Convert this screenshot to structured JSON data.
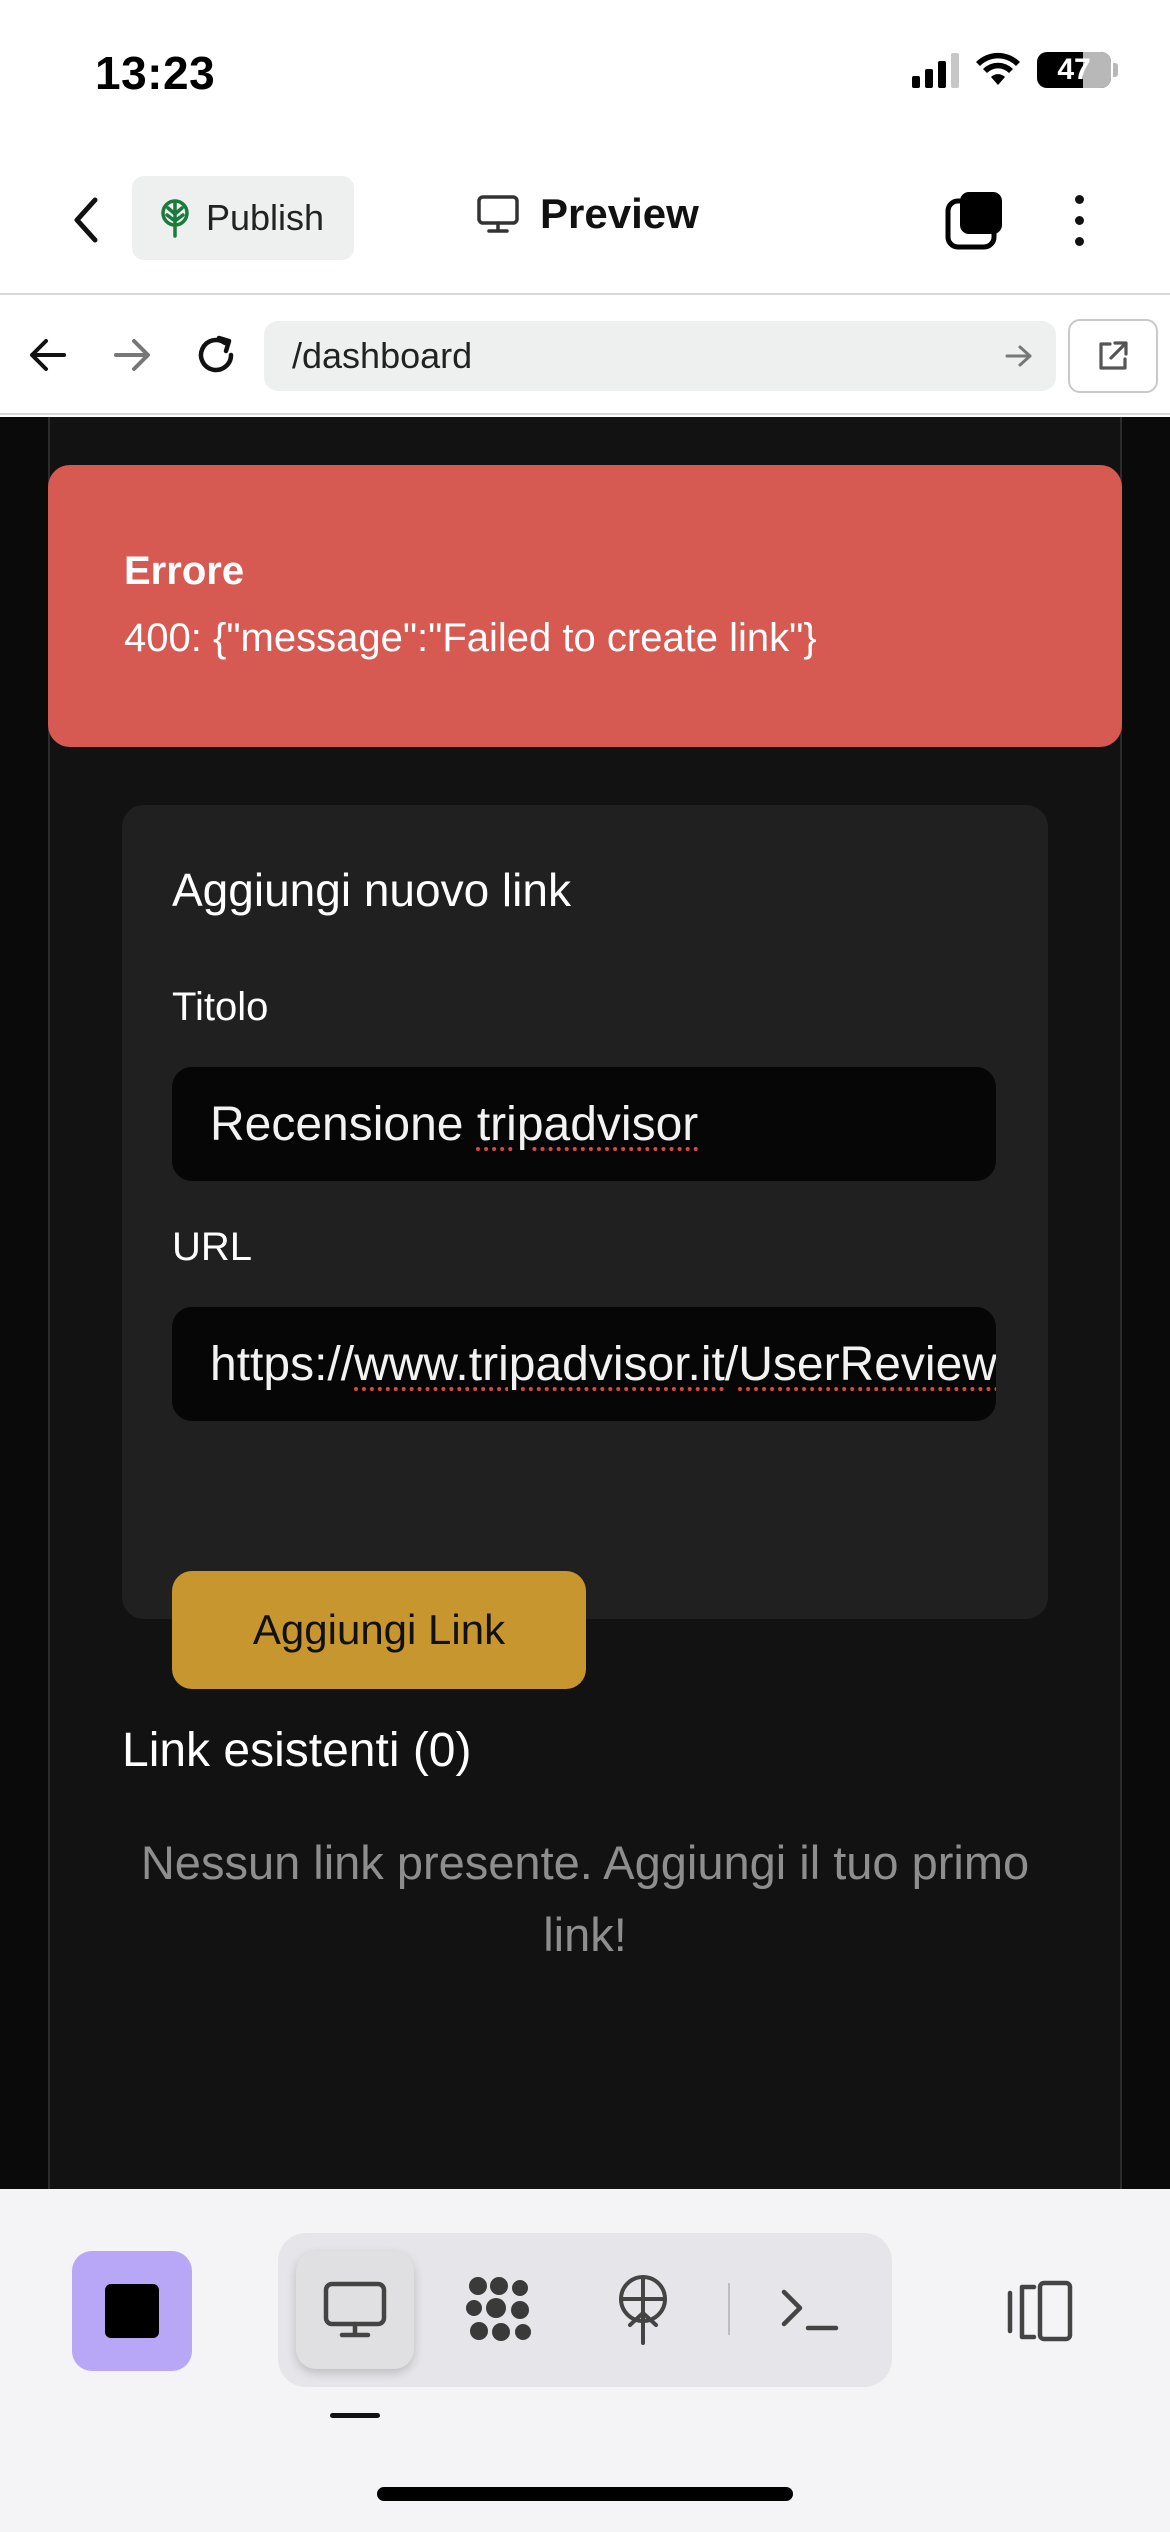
{
  "status_bar": {
    "time": "13:23",
    "battery": "47"
  },
  "app_bar": {
    "publish_label": "Publish",
    "title": "Preview"
  },
  "url_bar": {
    "url": "/dashboard"
  },
  "error": {
    "title": "Errore",
    "message": "400: {\"message\":\"Failed to create link\"}"
  },
  "form": {
    "heading": "Aggiungi nuovo link",
    "title_label": "Titolo",
    "title_value_prefix": "Recensione ",
    "title_value_misspelled": "tripadvisor",
    "url_label": "URL",
    "url_value_prefix": "https://",
    "url_value_misspelled1": "www.tripadvisor.it",
    "url_value_sep": "/",
    "url_value_misspelled2": "UserReviewEdit",
    "submit_label": "Aggiungi Link"
  },
  "links": {
    "heading": "Link esistenti (0)",
    "empty_message": "Nessun link presente. Aggiungi il tuo primo link!"
  },
  "bottom_bar": {
    "active_tool": "preview-icon",
    "tools": [
      "monitor-icon",
      "network-icon",
      "deploy-icon",
      "terminal-icon"
    ]
  },
  "colors": {
    "error_bg": "#d65a52",
    "accent_button": "#c8962e",
    "stop_button": "#b8a6f7"
  }
}
